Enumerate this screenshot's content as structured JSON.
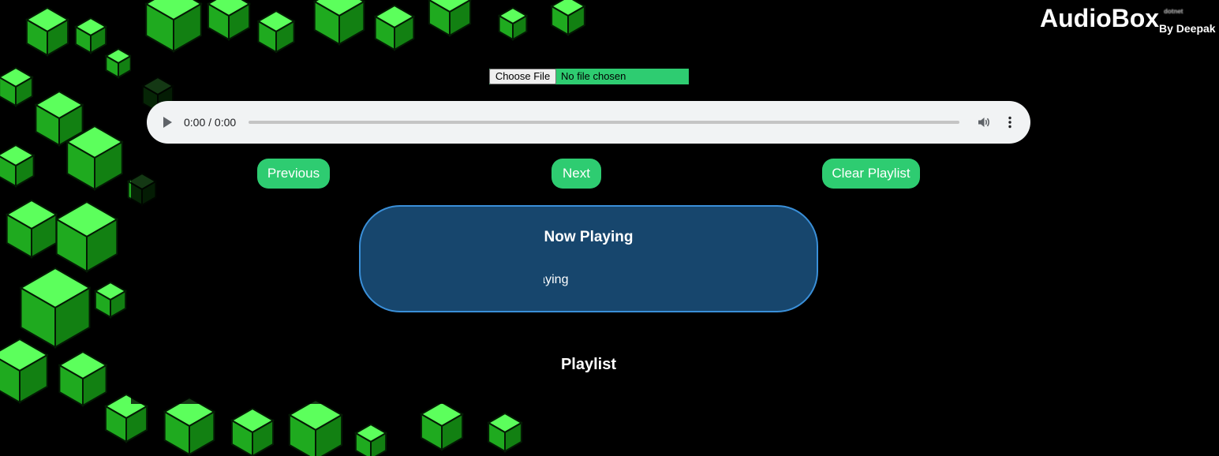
{
  "brand": {
    "title": "AudioBox",
    "mark": "dotnet",
    "byline": "By Deepak"
  },
  "file_input": {
    "button_label": "Choose File",
    "status_text": "No file chosen"
  },
  "audio_player": {
    "time": "0:00 / 0:00",
    "progress": 0,
    "icons": [
      "play-icon",
      "volume-icon",
      "more-options-icon"
    ]
  },
  "controls": {
    "previous": "Previous",
    "next": "Next",
    "clear": "Clear Playlist"
  },
  "now_playing": {
    "heading": "Now Playing",
    "track": "Playing"
  },
  "playlist": {
    "heading": "Playlist",
    "items": []
  },
  "colors": {
    "accent": "#2ecc71",
    "card": "#1e5a8c",
    "card_border": "#3a8fd8",
    "background": "#000000",
    "cube_green": "#2ee82e"
  }
}
